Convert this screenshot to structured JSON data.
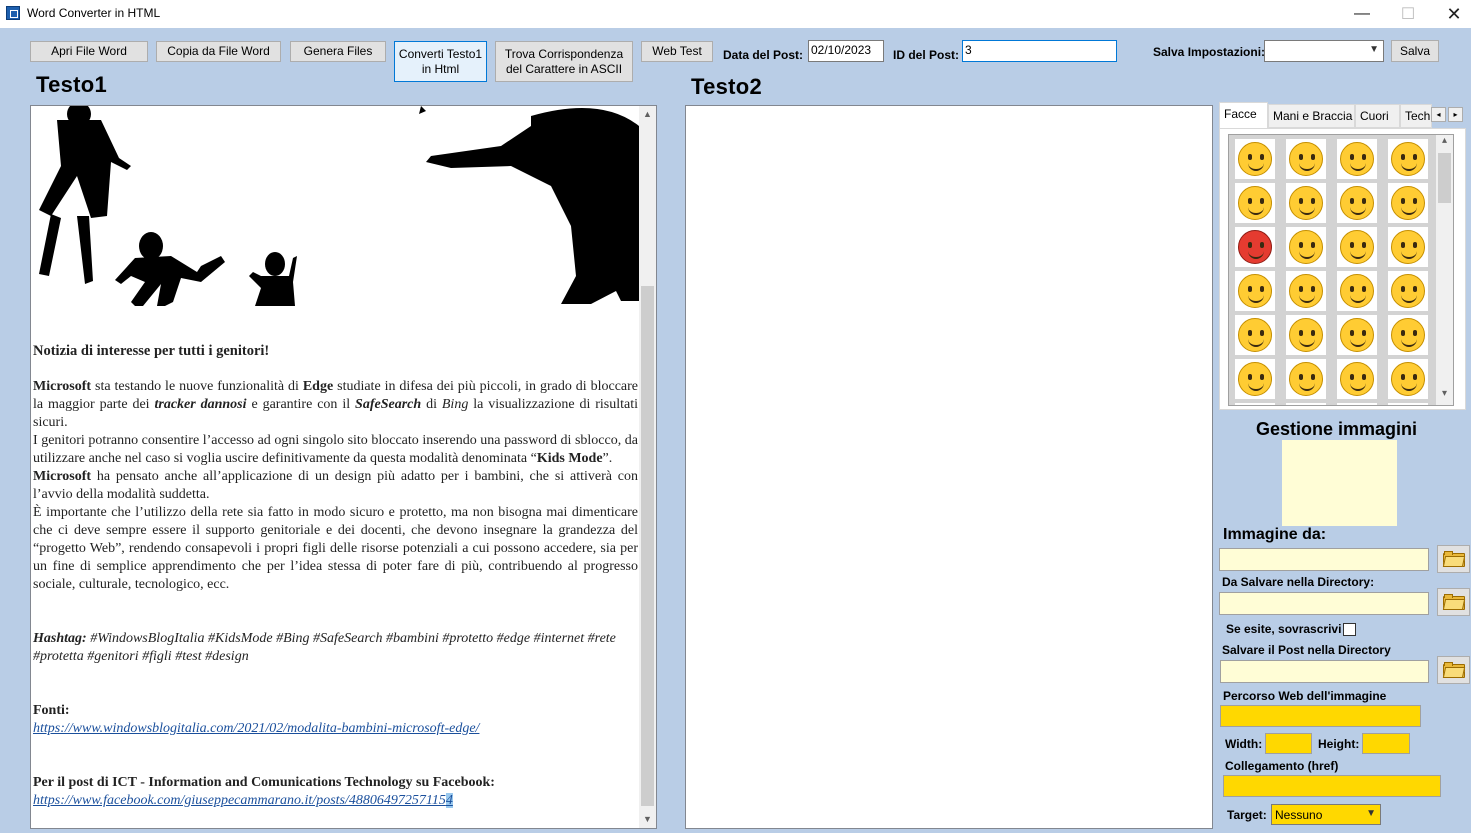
{
  "window": {
    "title": "Word Converter in HTML",
    "minimize": "—",
    "maximize": "☐",
    "close": "✕"
  },
  "toolbar": {
    "apri": "Apri File Word",
    "copia": "Copia da File Word",
    "genera": "Genera Files",
    "converti_l1": "Converti Testo1",
    "converti_l2": "in Html",
    "trova_l1": "Trova Corrispondenza",
    "trova_l2": "del Carattere in ASCII",
    "webtest": "Web Test",
    "data_label": "Data del Post:",
    "data_value": "02/10/2023",
    "id_label": "ID del Post:",
    "id_value": "3",
    "salva_impostazioni_label": "Salva Impostazioni:",
    "salva_impostazioni_value": "",
    "salva": "Salva"
  },
  "testo1": {
    "title": "Testo1",
    "heading": "Notizia di interesse per tutti i genitori!",
    "p1": [
      {
        "t": "Microsoft",
        "s": "b"
      },
      {
        "t": " sta testando le nuove funzionalità di ",
        "s": ""
      },
      {
        "t": "Edge",
        "s": "b"
      },
      {
        "t": " studiate in difesa dei più piccoli, in grado di bloccare la maggior parte dei ",
        "s": ""
      },
      {
        "t": "tracker dannosi",
        "s": "bi"
      },
      {
        "t": " e garantire con il ",
        "s": ""
      },
      {
        "t": "SafeSearch",
        "s": "bi"
      },
      {
        "t": " di ",
        "s": ""
      },
      {
        "t": "Bing",
        "s": "i"
      },
      {
        "t": " la visualizzazione di risultati sicuri.",
        "s": ""
      }
    ],
    "p2": [
      {
        "t": "I genitori potranno consentire l’accesso ad ogni singolo sito bloccato inserendo una password di sblocco, da utilizzare anche nel caso si voglia uscire definitivamente da questa modalità denominata “",
        "s": ""
      },
      {
        "t": "Kids Mode",
        "s": "b"
      },
      {
        "t": "”.",
        "s": ""
      }
    ],
    "p3": [
      {
        "t": "Microsoft",
        "s": "b"
      },
      {
        "t": " ha pensato anche all’applicazione di un design più adatto per i bambini, che si attiverà con l’avvio della modalità suddetta.",
        "s": ""
      }
    ],
    "p4": "È importante che l’utilizzo della rete sia fatto in modo sicuro e protetto, ma non bisogna mai dimenticare che ci deve sempre essere il supporto genitoriale e dei docenti, che devono insegnare la grandezza del “progetto Web”, rendendo consapevoli i propri figli delle risorse potenziali a cui possono accedere, sia per un fine di semplice apprendimento che per l’idea stessa di poter fare di più, contribuendo al progresso sociale, culturale, tecnologico, ecc.",
    "hashtag_label": "Hashtag:",
    "hashtags": " #WindowsBlogItalia #KidsMode #Bing #SafeSearch #bambini #protetto #edge #internet #rete #protetta #genitori #figli #test #design",
    "fonti_label": "Fonti:",
    "fonti_link": "https://www.windowsblogitalia.com/2021/02/modalita-bambini-microsoft-edge/",
    "ict_label": "Per il post di ICT - Information and Comunications Technology su Facebook:",
    "ict_link_main": "https://www.facebook.com/giuseppecammarano.it/posts/48806497257115",
    "ict_link_sel": "4"
  },
  "testo2": {
    "title": "Testo2"
  },
  "emoji_panel": {
    "tabs": [
      "Facce",
      "Mani e Braccia",
      "Cuori",
      "Tech"
    ],
    "selected_tab": "Facce",
    "prev": "◂",
    "next": "▸",
    "scroll_up": "▴",
    "scroll_down": "▾"
  },
  "gestione": {
    "title": "Gestione immagini",
    "immagine_da": "Immagine da:",
    "da_salvare": "Da Salvare nella Directory:",
    "se_esiste": "Se esite, sovrascrivi",
    "salvare_post": "Salvare il Post nella Directory",
    "percorso_web": "Percorso Web dell'immagine",
    "width": "Width:",
    "height": "Height:",
    "collegamento": "Collegamento (href)",
    "target_label": "Target:",
    "target_value": "Nessuno"
  },
  "colors": {
    "background": "#b9cde6",
    "yellow_field": "#fffdd6",
    "gold_field": "#ffd800",
    "link": "#1a4f9c"
  }
}
